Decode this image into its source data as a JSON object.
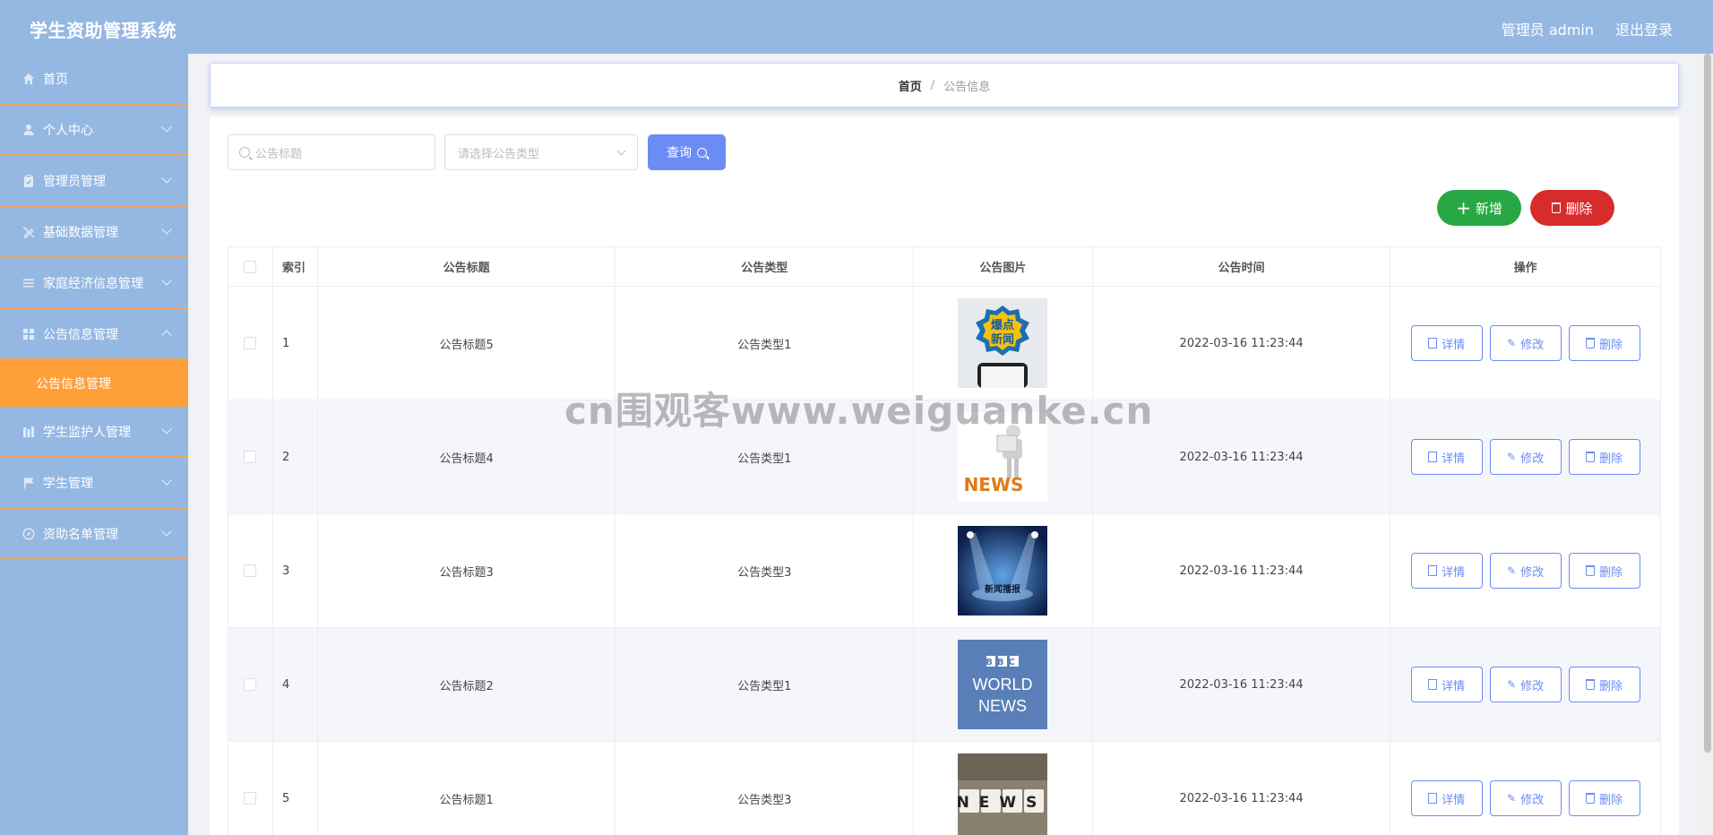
{
  "app": {
    "title": "学生资助管理系统"
  },
  "header": {
    "user_label": "管理员 admin",
    "logout_label": "退出登录"
  },
  "sidebar": {
    "items": [
      {
        "label": "首页",
        "icon": "home-icon",
        "has_children": false
      },
      {
        "label": "个人中心",
        "icon": "user-icon",
        "has_children": true
      },
      {
        "label": "管理员管理",
        "icon": "clipboard-icon",
        "has_children": true
      },
      {
        "label": "基础数据管理",
        "icon": "pen-off-icon",
        "has_children": true
      },
      {
        "label": "家庭经济信息管理",
        "icon": "list-icon",
        "has_children": true
      },
      {
        "label": "公告信息管理",
        "icon": "grid-icon",
        "has_children": true,
        "open": true,
        "children": [
          {
            "label": "公告信息管理",
            "active": true
          }
        ]
      },
      {
        "label": "学生监护人管理",
        "icon": "chart-icon",
        "has_children": true
      },
      {
        "label": "学生管理",
        "icon": "flag-icon",
        "has_children": true
      },
      {
        "label": "资助名单管理",
        "icon": "compass-icon",
        "has_children": true
      }
    ],
    "colors": {
      "background": "#95b8e3",
      "divider": "#f2a65a",
      "active": "#ff9f3a"
    }
  },
  "breadcrumb": {
    "home": "首页",
    "separator": "/",
    "current": "公告信息"
  },
  "filters": {
    "title_placeholder": "公告标题",
    "type_placeholder": "请选择公告类型",
    "query_label": "查询"
  },
  "actions": {
    "add_label": "新增",
    "delete_label": "删除"
  },
  "table": {
    "columns": [
      "索引",
      "公告标题",
      "公告类型",
      "公告图片",
      "公告时间",
      "操作"
    ],
    "rows": [
      {
        "index": "1",
        "title": "公告标题5",
        "type": "公告类型1",
        "image": "breaking-news-phone",
        "time": "2022-03-16 11:23:44"
      },
      {
        "index": "2",
        "title": "公告标题4",
        "type": "公告类型1",
        "image": "news-reader-figure",
        "time": "2022-03-16 11:23:44"
      },
      {
        "index": "3",
        "title": "公告标题3",
        "type": "公告类型3",
        "image": "news-broadcast-stage",
        "time": "2022-03-16 11:23:44"
      },
      {
        "index": "4",
        "title": "公告标题2",
        "type": "公告类型1",
        "image": "bbc-world-news",
        "time": "2022-03-16 11:23:44"
      },
      {
        "index": "5",
        "title": "公告标题1",
        "type": "公告类型3",
        "image": "news-blocks",
        "time": "2022-03-16 11:23:44"
      }
    ],
    "row_actions": {
      "detail": "详情",
      "edit": "修改",
      "delete": "删除"
    }
  },
  "thumb_text": {
    "t1": [
      "爆点",
      "新闻"
    ],
    "t2": "NEWS",
    "t3": "新闻播报",
    "t4": [
      "BBC",
      "WORLD",
      "NEWS"
    ],
    "t5": "NEWS"
  },
  "watermark": "cn围观客www.weiguanke.cn"
}
